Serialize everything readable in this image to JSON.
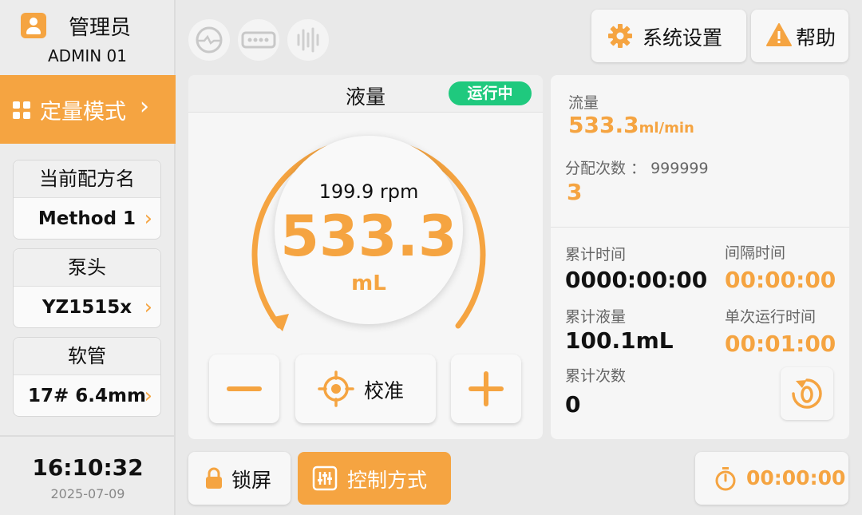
{
  "user": {
    "role": "管理员",
    "id": "ADMIN 01"
  },
  "mode": {
    "label": "定量模式"
  },
  "sidebar": {
    "cards": [
      {
        "title": "当前配方名",
        "value": "Method 1"
      },
      {
        "title": "泵头",
        "value": "YZ1515x"
      },
      {
        "title": "软管",
        "value": "17# 6.4mm"
      }
    ],
    "time": "16:10:32",
    "date": "2025-07-09"
  },
  "header": {
    "settings_label": "系统设置",
    "help_label": "帮助"
  },
  "volume": {
    "title": "液量",
    "status": "运行中",
    "rpm": "199.9 rpm",
    "value": "533.3",
    "unit": "mL",
    "calibrate_label": "校准"
  },
  "info": {
    "flow_label": "流量",
    "flow_value": "533.3",
    "flow_unit": "ml/min",
    "dispense_label": "分配次数 ： 999999",
    "dispense_value": "3",
    "total_time_label": "累计时间",
    "total_time_value": "0000:00:00",
    "interval_label": "间隔时间",
    "interval_value": "00:00:00",
    "total_volume_label": "累计液量",
    "total_volume_value": "100.1mL",
    "single_run_label": "单次运行时间",
    "single_run_value": "00:01:00",
    "total_count_label": "累计次数",
    "total_count_value": "0"
  },
  "footer": {
    "lock_label": "锁屏",
    "control_label": "控制方式",
    "timer_value": "00:00:00"
  },
  "colors": {
    "accent": "#f5a441",
    "running": "#1fc97e"
  }
}
